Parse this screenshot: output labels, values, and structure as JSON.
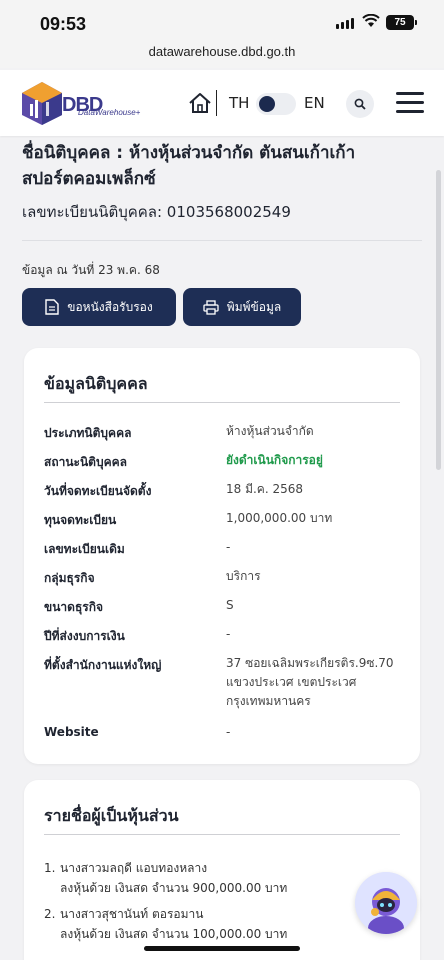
{
  "status_bar": {
    "time": "09:53",
    "battery": "75"
  },
  "url": "datawarehouse.dbd.go.th",
  "header": {
    "logo_text": "DBD",
    "logo_sub": "DataWarehouse+",
    "lang_th": "TH",
    "lang_en": "EN",
    "icons": [
      "home-icon",
      "search-icon",
      "menu-icon"
    ]
  },
  "company": {
    "name": "ชื่อนิติบุคคล : ห้างหุ้นส่วนจำกัด ตันสนเก้าเก้า สปอร์ตคอมเพล็กซ์",
    "reg_no": "เลขทะเบียนนิติบุคคล: 0103568002549",
    "as_of": "ข้อมูล ณ วันที่ 23 พ.ค. 68"
  },
  "actions": {
    "certificate_label": "ขอหนังสือรับรอง",
    "print_label": "พิมพ์ข้อมูล"
  },
  "info_card": {
    "title": "ข้อมูลนิติบุคคล",
    "rows": [
      {
        "label": "ประเภทนิติบุคคล",
        "value": "ห้างหุ้นส่วนจำกัด"
      },
      {
        "label": "สถานะนิติบุคคล",
        "value": "ยังดำเนินกิจการอยู่"
      },
      {
        "label": "วันที่จดทะเบียนจัดตั้ง",
        "value": "18 มี.ค. 2568"
      },
      {
        "label": "ทุนจดทะเบียน",
        "value": "1,000,000.00 บาท"
      },
      {
        "label": "เลขทะเบียนเดิม",
        "value": "-"
      },
      {
        "label": "กลุ่มธุรกิจ",
        "value": "บริการ"
      },
      {
        "label": "ขนาดธุรกิจ",
        "value": "S"
      },
      {
        "label": "ปีที่ส่งงบการเงิน",
        "value": "-"
      },
      {
        "label": "ที่ตั้งสำนักงานแห่งใหญ่",
        "value": "37 ซอยเฉลิมพระเกียรติร.9ซ.70 แขวงประเวศ เขตประเวศ กรุงเทพมหานคร"
      },
      {
        "label": "Website",
        "value": "-"
      }
    ]
  },
  "partners_card": {
    "title": "รายชื่อผู้เป็นหุ้นส่วน",
    "partners": [
      {
        "num": "1.",
        "name": "นางสาวมลฤดี แอบทองหลาง",
        "detail": "ลงหุ้นด้วย เงินสด จำนวน 900,000.00 บาท"
      },
      {
        "num": "2.",
        "name": "นางสาวสุชานันท์ ตอรอมาน",
        "detail": "ลงหุ้นด้วย เงินสด จำนวน 100,000.00 บาท"
      }
    ]
  },
  "colors": {
    "primary": "#1e2e55",
    "status_active": "#1f9a4b",
    "logo": "#3b3a8c"
  }
}
